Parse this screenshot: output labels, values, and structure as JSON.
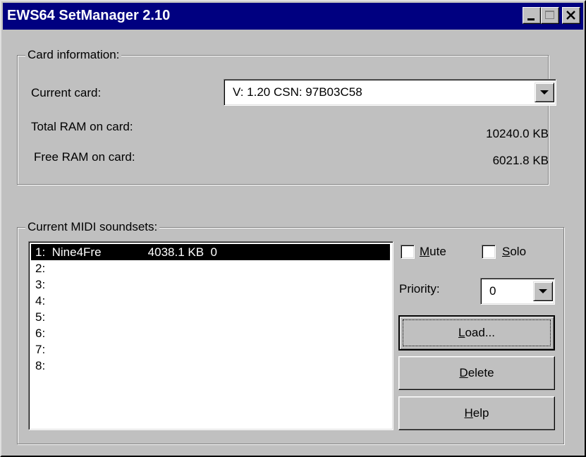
{
  "window": {
    "title": "EWS64 SetManager 2.10"
  },
  "card_info": {
    "group_label": "Card information:",
    "current_card_label": "Current card:",
    "current_card_value": "V: 1.20  CSN: 97B03C58",
    "total_ram_label": "Total RAM on card:",
    "total_ram_value": "10240.0 KB",
    "free_ram_label": "Free RAM on card:",
    "free_ram_value": "6021.8 KB"
  },
  "soundsets": {
    "group_label": "Current MIDI soundsets:",
    "items": [
      "1:  Nine4Fre              4038.1 KB  0",
      "2:",
      "3:",
      "4:",
      "5:",
      "6:",
      "7:",
      "8:"
    ],
    "selected_index": 0
  },
  "controls": {
    "mute_label": {
      "key": "M",
      "rest": "ute"
    },
    "solo_label": {
      "key": "S",
      "rest": "olo"
    },
    "priority_label": "Priority:",
    "priority_value": "0",
    "load_label": {
      "key": "L",
      "rest": "oad..."
    },
    "delete_label": {
      "key": "D",
      "rest": "elete"
    },
    "help_label": {
      "key": "H",
      "rest": "elp"
    }
  },
  "icons": {
    "minimize": "minimize-icon",
    "maximize": "maximize-icon",
    "close": "close-icon",
    "dropdown": "chevron-down-icon"
  }
}
